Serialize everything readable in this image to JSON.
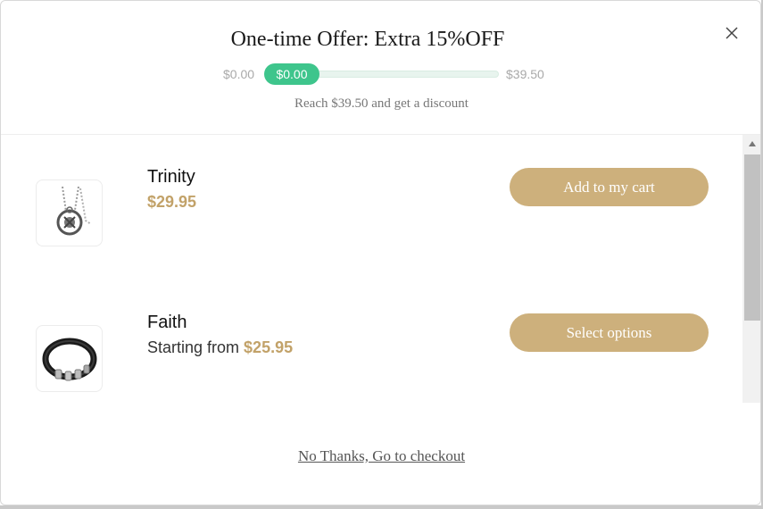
{
  "header": {
    "title": "One-time Offer: Extra 15%OFF",
    "close_icon": "close-icon"
  },
  "progress": {
    "start_label": "$0.00",
    "current_label": "$0.00",
    "end_label": "$39.50",
    "fraction": 0.0,
    "hint": "Reach $39.50 and get a discount",
    "fill_color": "#3ec58c"
  },
  "products": [
    {
      "name": "Trinity",
      "price": "$29.95",
      "cta_label": "Add to my cart",
      "thumb_icon": "necklace-pendant-icon"
    },
    {
      "name": "Faith",
      "price_prefix": "Starting from ",
      "price": "$25.95",
      "cta_label": "Select options",
      "thumb_icon": "leather-bracelet-icon"
    }
  ],
  "footer": {
    "decline_label": "No Thanks, Go to checkout"
  },
  "colors": {
    "accent_gold": "#cdb07c",
    "price_gold": "#c2a269",
    "progress_green": "#3ec58c"
  }
}
